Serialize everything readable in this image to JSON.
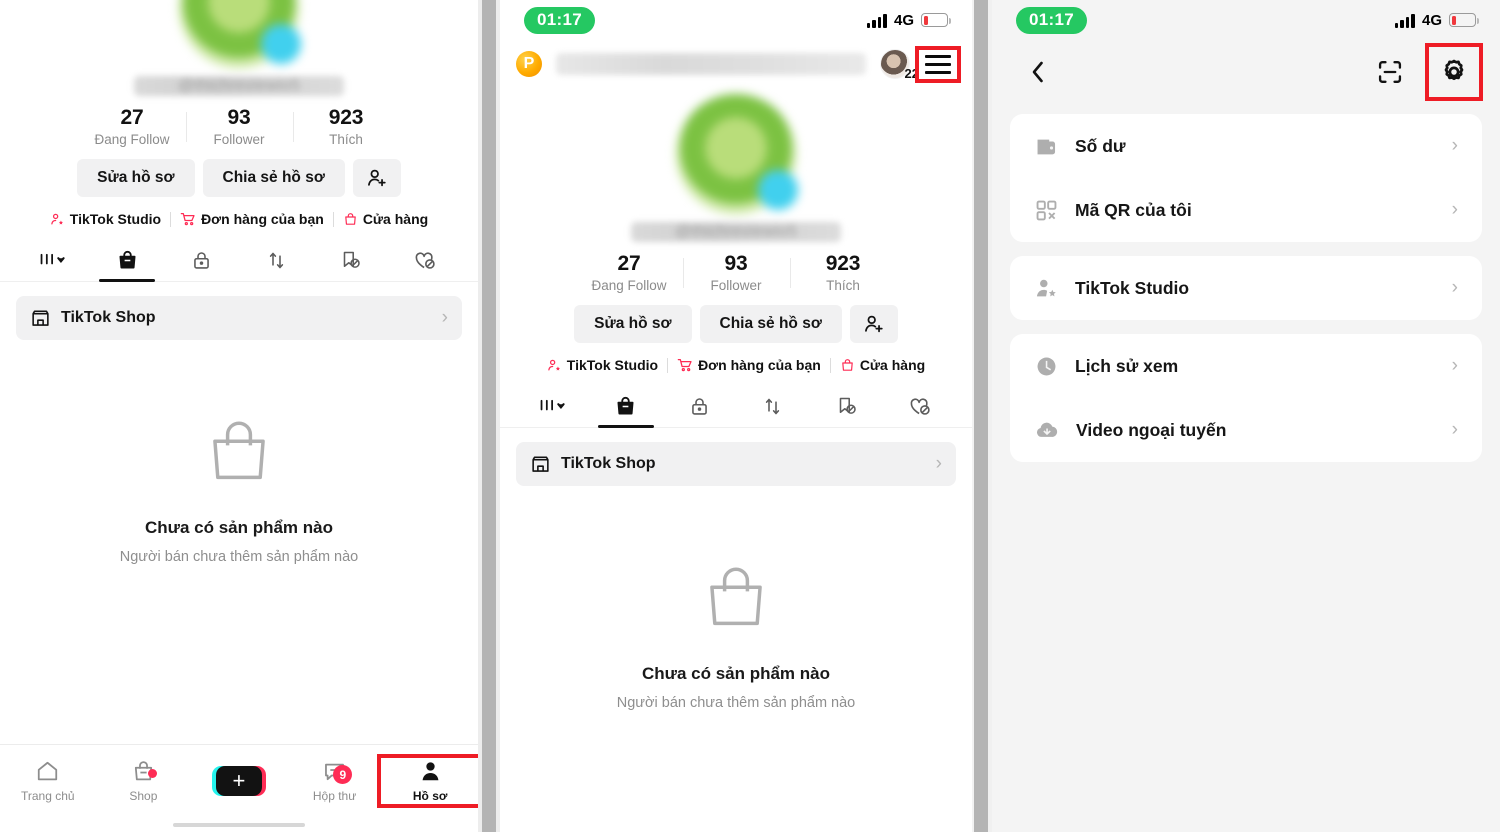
{
  "status_bar": {
    "time": "01:17",
    "network": "4G",
    "battery_level_pct": 12
  },
  "panel_profile_top": {
    "username_placeholder": "@thichreviewio5",
    "stats": [
      {
        "num": "27",
        "label": "Đang Follow"
      },
      {
        "num": "93",
        "label": "Follower"
      },
      {
        "num": "923",
        "label": "Thích"
      }
    ],
    "actions": {
      "edit_profile": "Sửa hồ sơ",
      "share_profile": "Chia sẻ hồ sơ",
      "add_friend_icon": "add-person-icon"
    },
    "quicklinks": [
      {
        "label": "TikTok Studio",
        "icon": "person-star-icon"
      },
      {
        "label": "Đơn hàng của bạn",
        "icon": "shopping-cart-icon"
      },
      {
        "label": "Cửa hàng",
        "icon": "shop-bag-icon"
      }
    ],
    "tabs": [
      {
        "icon": "grid-dropdown-icon",
        "active": false
      },
      {
        "icon": "shopping-bag-icon",
        "active": true
      },
      {
        "icon": "lock-icon",
        "active": false
      },
      {
        "icon": "repost-icon",
        "active": false
      },
      {
        "icon": "bookmark-hidden-icon",
        "active": false
      },
      {
        "icon": "heart-hidden-icon",
        "active": false
      }
    ],
    "shop_row": {
      "label": "TikTok Shop",
      "icon": "storefront-icon",
      "chevron": "›"
    },
    "empty_state": {
      "icon": "shopping-bag-outline-icon",
      "title": "Chưa có sản phẩm nào",
      "subtitle": "Người bán chưa thêm sản phẩm nào"
    },
    "bottom_nav": [
      {
        "label": "Trang chủ",
        "icon": "home-icon",
        "badge": "",
        "dot": false,
        "active": false
      },
      {
        "label": "Shop",
        "icon": "shop-icon",
        "badge": "",
        "dot": true,
        "active": false
      },
      {
        "label": "",
        "icon": "plus-icon",
        "badge": "",
        "dot": false,
        "active": false
      },
      {
        "label": "Hộp thư",
        "icon": "inbox-icon",
        "badge": "9",
        "dot": false,
        "active": false
      },
      {
        "label": "Hồ sơ",
        "icon": "profile-icon",
        "badge": "",
        "dot": false,
        "active": true
      }
    ]
  },
  "panel_profile_full": {
    "p_badge": "P",
    "header_avatar_count": "22",
    "menu_icon": "hamburger-menu-icon",
    "username_placeholder": "@thichreviewio5",
    "stats": [
      {
        "num": "27",
        "label": "Đang Follow"
      },
      {
        "num": "93",
        "label": "Follower"
      },
      {
        "num": "923",
        "label": "Thích"
      }
    ],
    "actions": {
      "edit_profile": "Sửa hồ sơ",
      "share_profile": "Chia sẻ hồ sơ",
      "add_friend_icon": "add-person-icon"
    },
    "quicklinks": [
      {
        "label": "TikTok Studio",
        "icon": "person-star-icon"
      },
      {
        "label": "Đơn hàng của bạn",
        "icon": "shopping-cart-icon"
      },
      {
        "label": "Cửa hàng",
        "icon": "shop-bag-icon"
      }
    ],
    "shop_row": {
      "label": "TikTok Shop",
      "icon": "storefront-icon",
      "chevron": "›"
    },
    "empty_state": {
      "icon": "shopping-bag-outline-icon",
      "title": "Chưa có sản phẩm nào",
      "subtitle": "Người bán chưa thêm sản phẩm nào"
    }
  },
  "panel_settings": {
    "back_icon": "back-chevron-icon",
    "scan_icon": "qr-scan-icon",
    "settings_icon": "gear-icon",
    "groups": [
      {
        "rows": [
          {
            "label": "Số dư",
            "icon": "wallet-icon",
            "chevron": "›"
          },
          {
            "label": "Mã QR của tôi",
            "icon": "qr-code-icon",
            "chevron": "›"
          }
        ]
      },
      {
        "rows": [
          {
            "label": "TikTok Studio",
            "icon": "person-star-grey-icon",
            "chevron": "›"
          }
        ]
      },
      {
        "rows": [
          {
            "label": "Lịch sử xem",
            "icon": "clock-icon",
            "chevron": "›"
          },
          {
            "label": "Video ngoại tuyến",
            "icon": "cloud-download-icon",
            "chevron": "›"
          }
        ]
      }
    ]
  },
  "annotations": {
    "highlight_color": "#ee1c25",
    "highlights": [
      "profile-tab-bottom-nav",
      "hamburger-menu-icon",
      "gear-icon"
    ]
  }
}
